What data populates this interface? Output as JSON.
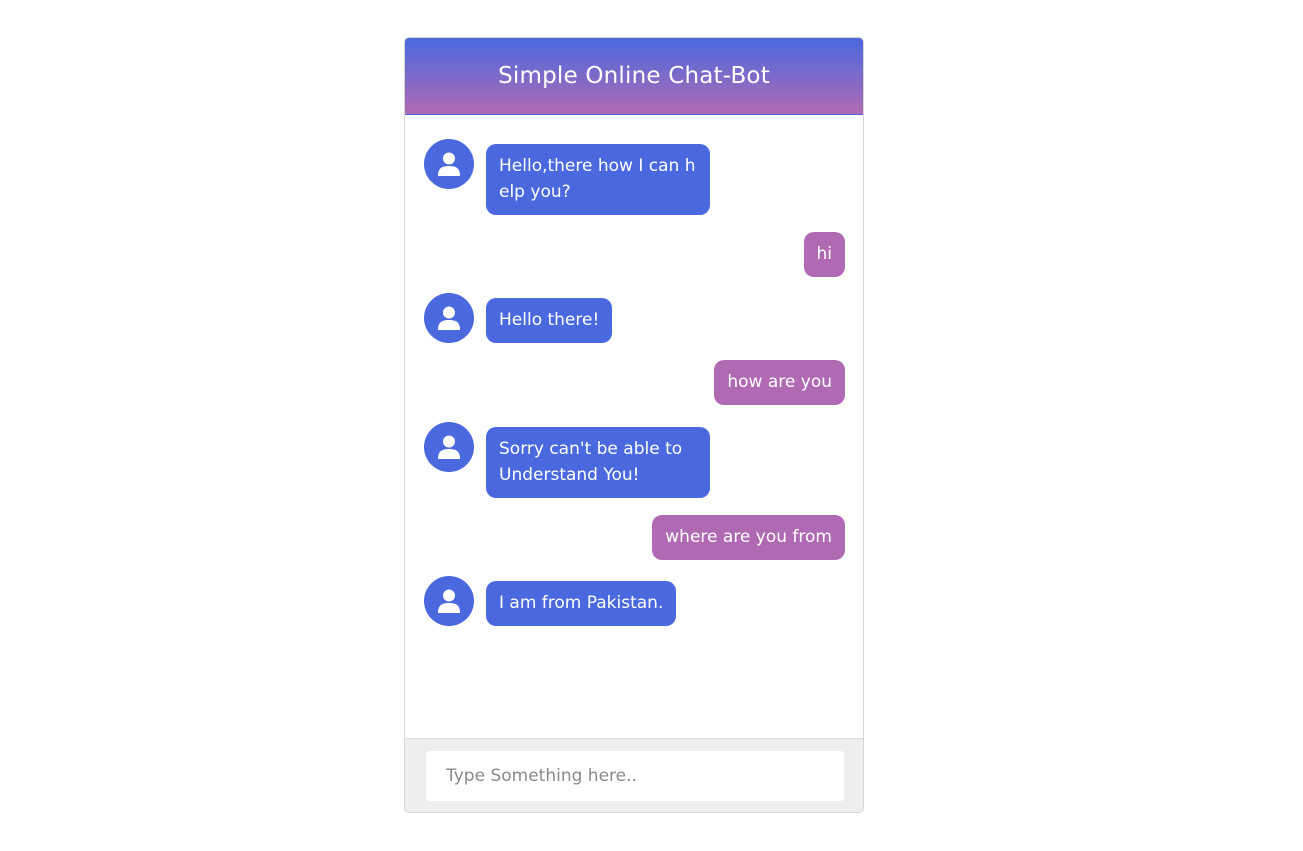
{
  "header": {
    "title": "Simple Online Chat-Bot"
  },
  "messages": [
    {
      "sender": "bot",
      "lines": [
        "Hello,there how I can h",
        "elp you?"
      ]
    },
    {
      "sender": "user",
      "text": "hi"
    },
    {
      "sender": "bot",
      "text": "Hello there!"
    },
    {
      "sender": "user",
      "text": "how are you"
    },
    {
      "sender": "bot",
      "lines": [
        "Sorry can't be able to",
        "Understand You!"
      ]
    },
    {
      "sender": "user",
      "text": "where are you from"
    },
    {
      "sender": "bot",
      "text": "I am from Pakistan."
    }
  ],
  "input": {
    "placeholder": "Type Something here..",
    "value": ""
  },
  "colors": {
    "bot": "#4a69de",
    "user": "#b06ab3",
    "header_top": "#4a69de",
    "header_bottom": "#b06ab3",
    "footer": "#eeeeee"
  },
  "icons": {
    "bot_avatar": "user-icon"
  }
}
